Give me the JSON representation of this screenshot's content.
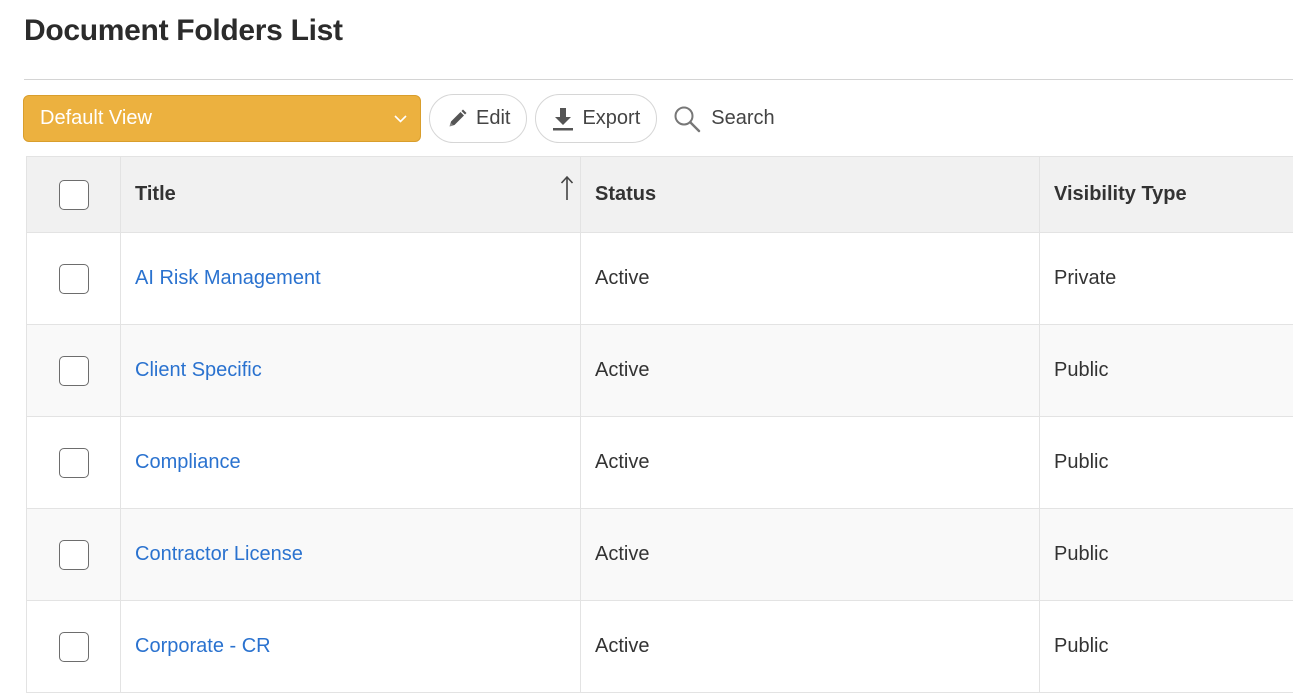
{
  "page": {
    "title": "Document Folders List"
  },
  "toolbar": {
    "view_label": "Default View",
    "edit_label": "Edit",
    "export_label": "Export",
    "search_label": "Search",
    "view_color": "#ecb13f"
  },
  "table": {
    "columns": [
      "Title",
      "Status",
      "Visibility Type"
    ],
    "sort": {
      "column": "Title",
      "direction": "ascending"
    },
    "rows": [
      {
        "title": "AI Risk Management",
        "status": "Active",
        "visibility": "Private"
      },
      {
        "title": "Client Specific",
        "status": "Active",
        "visibility": "Public"
      },
      {
        "title": "Compliance",
        "status": "Active",
        "visibility": "Public"
      },
      {
        "title": "Contractor License",
        "status": "Active",
        "visibility": "Public"
      },
      {
        "title": "Corporate - CR",
        "status": "Active",
        "visibility": "Public"
      }
    ]
  },
  "icons": {
    "view": "chevron-down-icon",
    "edit": "pencil-icon",
    "export": "download-icon",
    "search": "magnifier-icon",
    "sort": "arrow-up-icon"
  },
  "colors": {
    "link": "#2a72cf",
    "header_bg": "#f1f1f1"
  }
}
